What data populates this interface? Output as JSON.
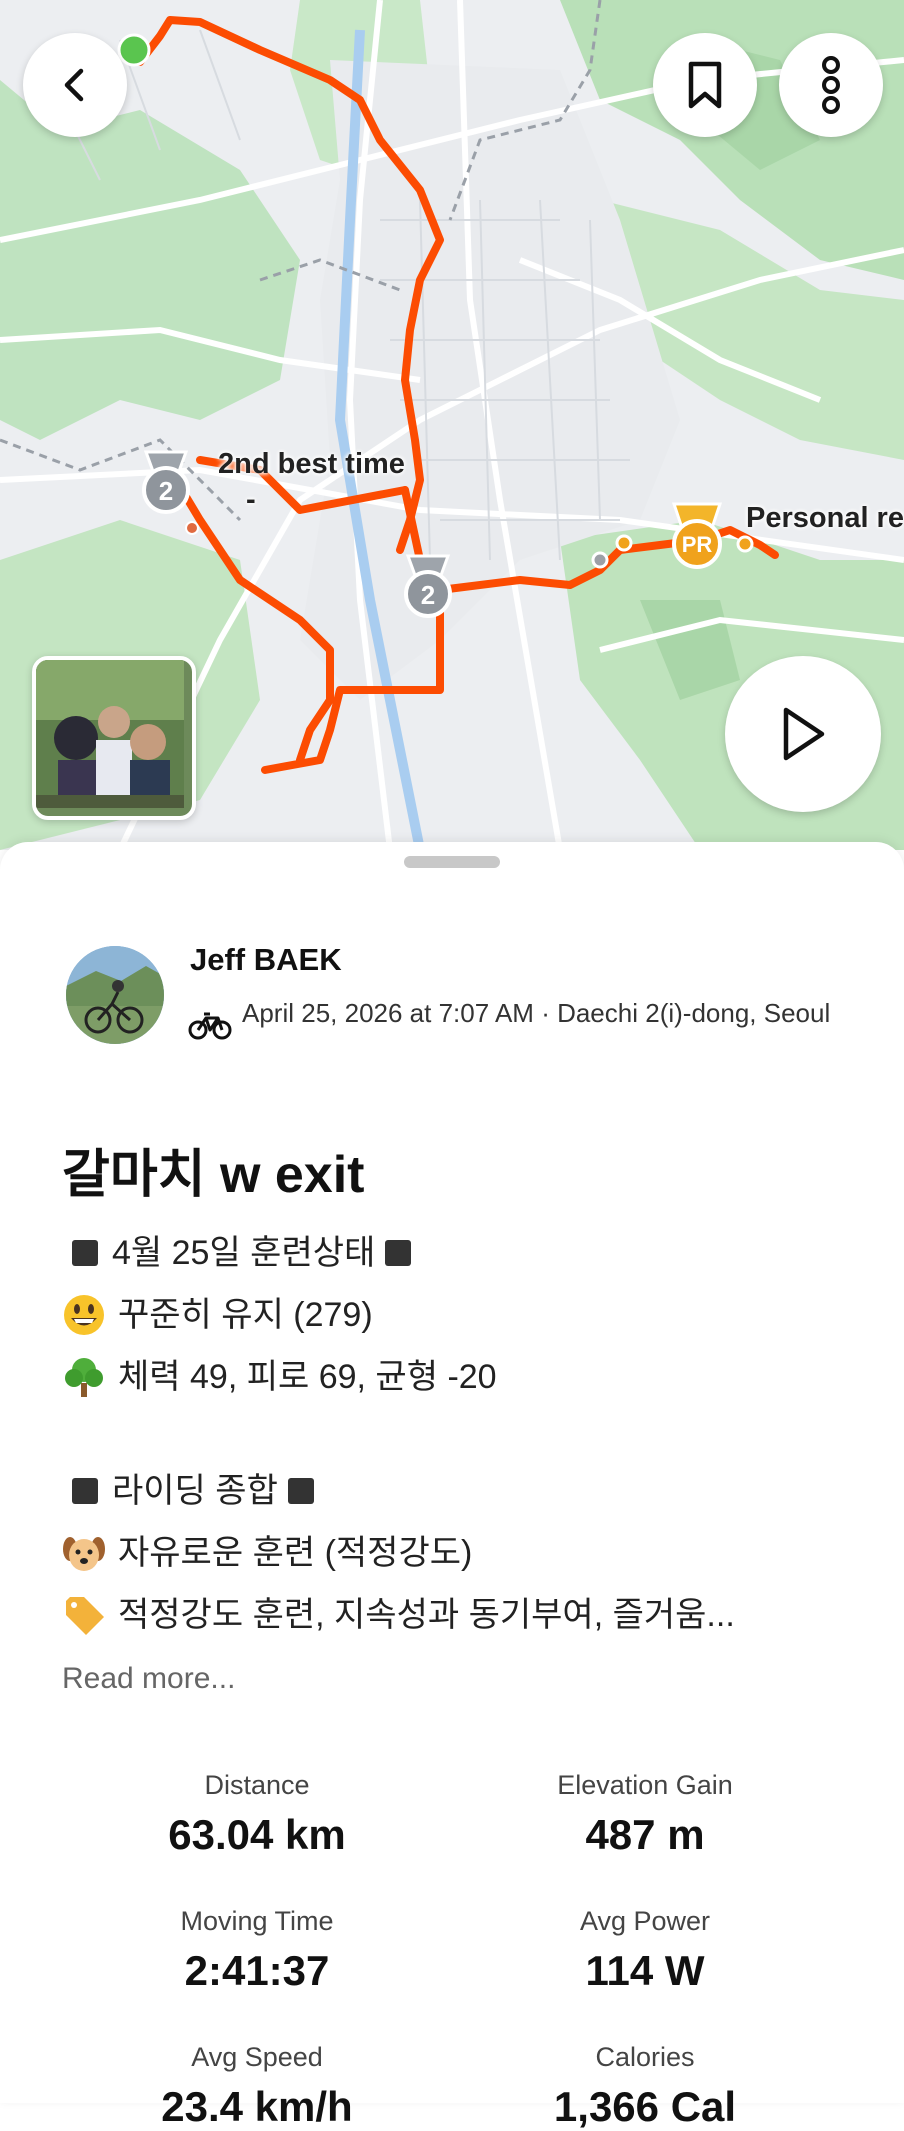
{
  "map": {
    "labels": {
      "second_best": "2nd best time",
      "second_best_sub": "-",
      "personal_record": "Personal re"
    },
    "badges": {
      "silver_rank": "2",
      "pr": "PR"
    },
    "route_color": "#fc4c02"
  },
  "buttons": {
    "back_icon": "chevron-left-icon",
    "bookmark_icon": "bookmark-icon",
    "more_icon": "more-vertical-icon",
    "play_icon": "play-icon"
  },
  "activity": {
    "athlete_name": "Jeff BAEK",
    "meta_text": "April 25, 2026 at 7:07 AM · Daechi 2(i)-dong, Seoul",
    "sport_icon": "bike-icon",
    "title": "갈마치 w exit",
    "description": {
      "line1": "4월 25일 훈련상태",
      "line2": "꾸준히 유지 (279)",
      "line3": "체력 49, 피로 69, 균형 -20",
      "line4": "라이딩 종합",
      "line5": "자유로운 훈련 (적정강도)",
      "line6": "적정강도 훈련, 지속성과 동기부여, 즐거움..."
    },
    "read_more": "Read more..."
  },
  "stats": {
    "distance": {
      "label": "Distance",
      "value": "63.04 km"
    },
    "elevation": {
      "label": "Elevation Gain",
      "value": "487 m"
    },
    "moving_time": {
      "label": "Moving Time",
      "value": "2:41:37"
    },
    "avg_power": {
      "label": "Avg Power",
      "value": "114 W"
    },
    "avg_speed": {
      "label": "Avg Speed",
      "value": "23.4 km/h"
    },
    "calories": {
      "label": "Calories",
      "value": "1,366 Cal"
    }
  }
}
